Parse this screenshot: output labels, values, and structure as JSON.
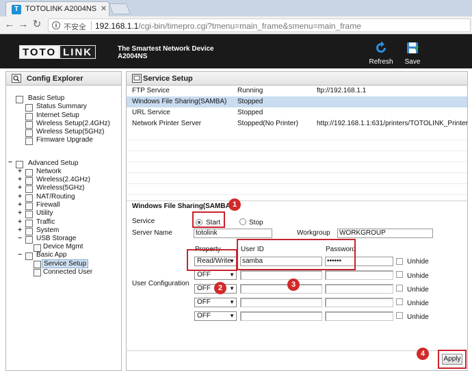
{
  "browser": {
    "tab_title": "TOTOLINK A2004NS",
    "tab_favicon": "T",
    "tab_close": "✕",
    "insecure_label": "不安全",
    "url_host": "192.168.1.1",
    "url_path": "/cgi-bin/timepro.cgi?tmenu=main_frame&smenu=main_frame"
  },
  "header": {
    "logo_left": "TOTO",
    "logo_right": "LINK",
    "slogan_line1": "The Smartest Network Device",
    "slogan_line2": "A2004NS",
    "refresh_label": "Refresh",
    "save_label": "Save"
  },
  "sidebar": {
    "title": "Config Explorer",
    "basic_setup": "Basic Setup",
    "basic_items": [
      "Status Summary",
      "Internet Setup",
      "Wireless Setup(2.4GHz)",
      "Wireless Setup(5GHz)",
      "Firmware Upgrade"
    ],
    "advanced_setup": "Advanced Setup",
    "advanced_items": [
      "Network",
      "Wireless(2.4GHz)",
      "Wireless(5GHz)",
      "NAT/Routing",
      "Firewall",
      "Utility",
      "Traffic",
      "System",
      "USB Storage"
    ],
    "usb_child": "Device Mgmt",
    "basic_app": "Basic App",
    "basic_app_items": [
      "Service Setup",
      "Connected User"
    ]
  },
  "main": {
    "title": "Service Setup",
    "services": [
      {
        "name": "FTP Service",
        "status": "Running",
        "address": "ftp://192.168.1.1"
      },
      {
        "name": "Windows File Sharing(SAMBA)",
        "status": "Stopped",
        "address": ""
      },
      {
        "name": "URL Service",
        "status": "Stopped",
        "address": ""
      },
      {
        "name": "Network Printer Server",
        "status": "Stopped(No Printer)",
        "address": "http://192.168.1.1:631/printers/TOTOLINK_Printer"
      }
    ],
    "section_title": "Windows File Sharing(SAMBA)",
    "service_label": "Service",
    "start_label": "Start",
    "stop_label": "Stop",
    "server_name_label": "Server Name",
    "server_name_value": "totolink",
    "workgroup_label": "Workgroup",
    "workgroup_value": "WORKGROUP",
    "property_label": "Property",
    "userid_label": "User ID",
    "password_label": "Password",
    "user_config_label": "User Configuration",
    "unhide_label": "Unhide",
    "users": [
      {
        "property": "Read/Write",
        "userid": "samba",
        "password": "••••••"
      },
      {
        "property": "OFF",
        "userid": "",
        "password": ""
      },
      {
        "property": "OFF",
        "userid": "",
        "password": ""
      },
      {
        "property": "OFF",
        "userid": "",
        "password": ""
      },
      {
        "property": "OFF",
        "userid": "",
        "password": ""
      }
    ],
    "apply_label": "Apply",
    "badges": [
      "1",
      "2",
      "3",
      "4"
    ],
    "arrow": "▼"
  },
  "colors": {
    "highlight": "#c8232c",
    "selection": "#c9dcf0"
  }
}
